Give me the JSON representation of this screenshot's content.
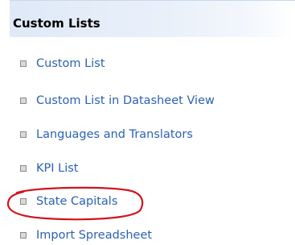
{
  "header": {
    "title": "Custom Lists"
  },
  "list": {
    "items": [
      {
        "label": "Custom List"
      },
      {
        "label": "Custom List in Datasheet View"
      },
      {
        "label": "Languages and Translators"
      },
      {
        "label": "KPI List"
      },
      {
        "label": "State Capitals"
      },
      {
        "label": "Import Spreadsheet"
      }
    ]
  },
  "colors": {
    "link": "#2b62b5",
    "header_gradient_start": "#dfe9f7",
    "highlight": "#d2141f"
  },
  "icons": {
    "bullet": "square-bullet-icon"
  }
}
